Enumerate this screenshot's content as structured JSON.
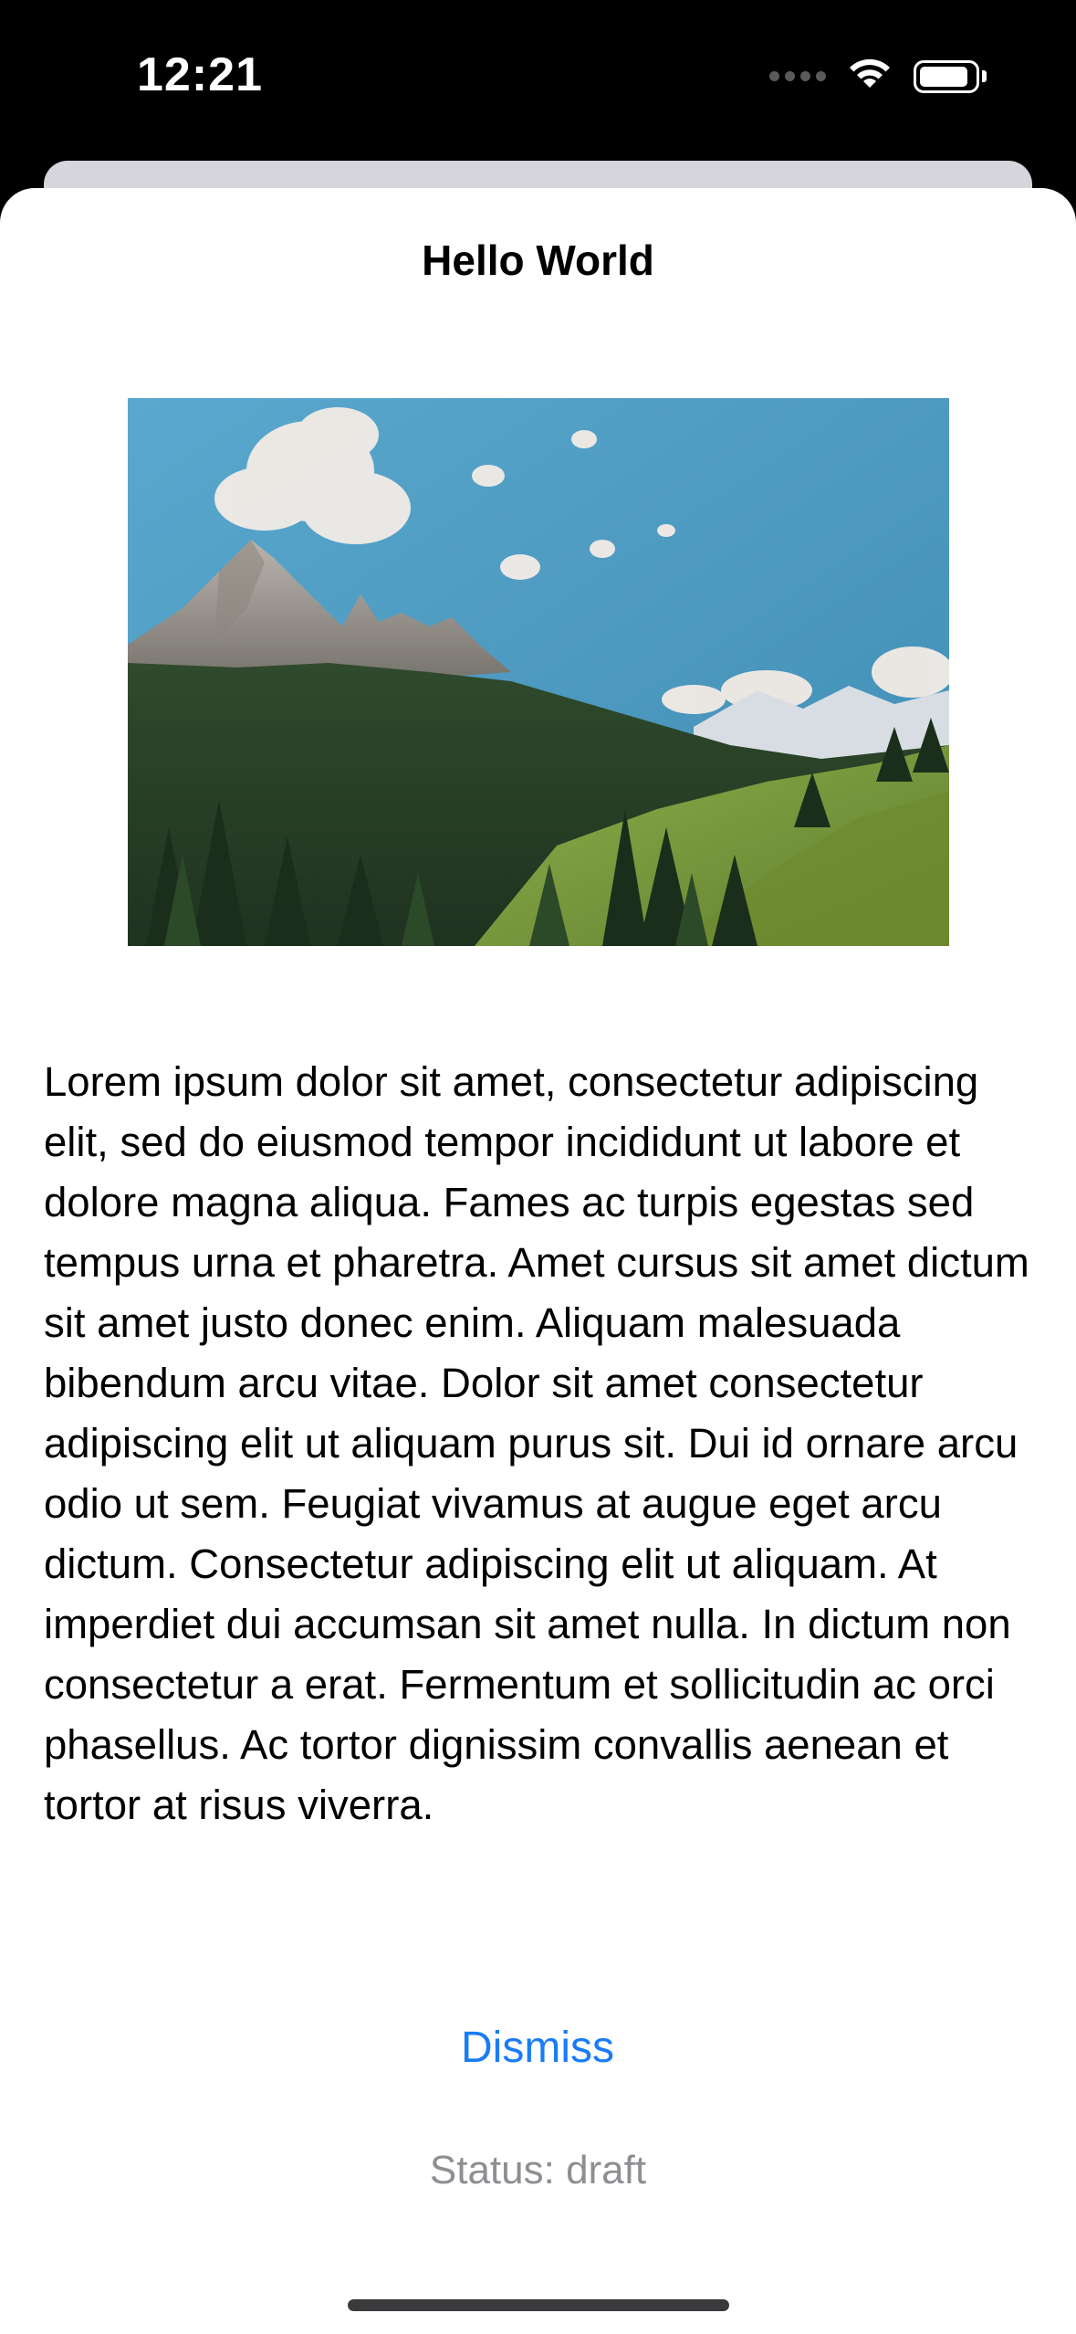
{
  "status_bar": {
    "time": "12:21",
    "battery_level": 0.9
  },
  "sheet": {
    "title": "Hello World",
    "image": {
      "alt": "mountain-landscape-photo"
    },
    "body": "Lorem ipsum dolor sit amet, consectetur adipiscing elit, sed do eiusmod tempor incididunt ut labore et dolore magna aliqua. Fames ac turpis egestas sed tempus urna et pharetra. Amet cursus sit amet dictum sit amet justo donec enim. Aliquam malesuada bibendum arcu vitae. Dolor sit amet consectetur adipiscing elit ut aliquam purus sit. Dui id ornare arcu odio ut sem. Feugiat vivamus at augue eget arcu dictum. Consectetur adipiscing elit ut aliquam. At imperdiet dui accumsan sit amet nulla. In dictum non consectetur a erat. Fermentum et sollicitudin ac orci phasellus. Ac tortor dignissim convallis aenean et tortor at risus viverra.",
    "dismiss_label": "Dismiss",
    "status_text": "Status: draft"
  },
  "colors": {
    "accent": "#1a7cf5",
    "secondary_text": "#8e8e93",
    "sheet_background": "#ffffff",
    "backdrop": "#000000"
  }
}
